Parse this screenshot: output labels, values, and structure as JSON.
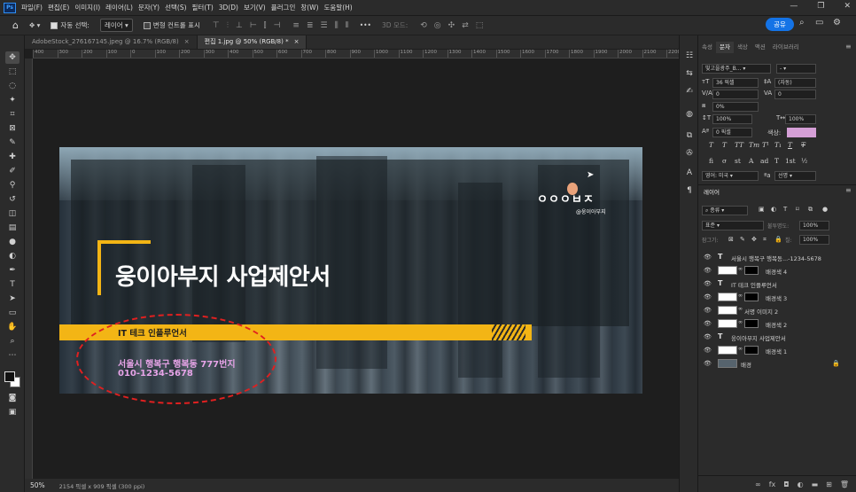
{
  "menubar": {
    "logo": "Ps",
    "items": [
      "파일(F)",
      "편집(E)",
      "이미지(I)",
      "레이어(L)",
      "문자(Y)",
      "선택(S)",
      "필터(T)",
      "3D(D)",
      "보기(V)",
      "플러그인",
      "창(W)",
      "도움말(H)"
    ],
    "window_controls": [
      "—",
      "❐",
      "✕"
    ]
  },
  "options": {
    "auto_select_label": "자동 선택:",
    "auto_select_value": "레이어",
    "transform_label": "변형 컨트롤 표시",
    "more": "•••",
    "mode_3d": "3D 모드:",
    "share": "공유"
  },
  "tabs": [
    {
      "label": "AdobeStock_276167145.jpeg @ 16.7% (RGB/8)",
      "close": "×"
    },
    {
      "label": "편집 1.jpg @ 50% (RGB/8) *",
      "close": "×"
    }
  ],
  "ruler": [
    "400",
    "300",
    "200",
    "100",
    "0",
    "100",
    "200",
    "300",
    "400",
    "500",
    "600",
    "700",
    "800",
    "900",
    "1000",
    "1100",
    "1200",
    "1300",
    "1400",
    "1500",
    "1600",
    "1700",
    "1800",
    "1900",
    "2000",
    "2100",
    "2200"
  ],
  "canvas": {
    "title": "웅이아부지 사업제안서",
    "band_label": "IT 테크 인플루언서",
    "address": "서울시 행복구 행복동 777번지",
    "phone": "010-1234-5678",
    "brand": "ㅇㅇㅇㅂㅈ",
    "brand_sub": "@웅이아부지"
  },
  "status": {
    "zoom": "50%",
    "info": "2154 픽셀 x 909 픽셀 (300 ppi)"
  },
  "panel": {
    "tabs": [
      "속성",
      "문자",
      "색상",
      "액션",
      "라이브러리"
    ],
    "active_tab": "문자",
    "font_family": "빛고을광주_B...",
    "font_style": "-",
    "font_size": "36 픽셀",
    "leading": "(자동)",
    "kerning": "0",
    "tracking": "0",
    "vertical_scale_field": "0%",
    "scale_v": "100%",
    "scale_h": "100%",
    "baseline": "0 픽셀",
    "color_label": "색상:",
    "glyph_row1": [
      "T",
      "T",
      "TT",
      "Tт",
      "T¹",
      "T₁",
      "T",
      "T"
    ],
    "glyph_row2": [
      "fi",
      "σ",
      "st",
      "A",
      "ad",
      "T",
      "1st",
      "½"
    ],
    "language": "영어: 미국",
    "antialias": "선명"
  },
  "layers": {
    "header": "레이어",
    "filter": "종류",
    "blend": "표준",
    "opacity_label": "불투명도:",
    "opacity": "100%",
    "lock_label": "잠그기:",
    "fill_label": "칠:",
    "fill": "100%",
    "rows": [
      {
        "type": "text",
        "name": "서울시 행복구 행복동...-1234-5678"
      },
      {
        "type": "shape",
        "name": "배경색 4"
      },
      {
        "type": "text",
        "name": "IT 테크 인플루언서"
      },
      {
        "type": "shape",
        "name": "배경색 3"
      },
      {
        "type": "shape",
        "name": "서명 이미지 2"
      },
      {
        "type": "shape",
        "name": "배경색 2"
      },
      {
        "type": "text",
        "name": "웅이아부지 사업제안서"
      },
      {
        "type": "shape",
        "name": "배경색 1"
      },
      {
        "type": "image",
        "name": "배경"
      }
    ]
  }
}
